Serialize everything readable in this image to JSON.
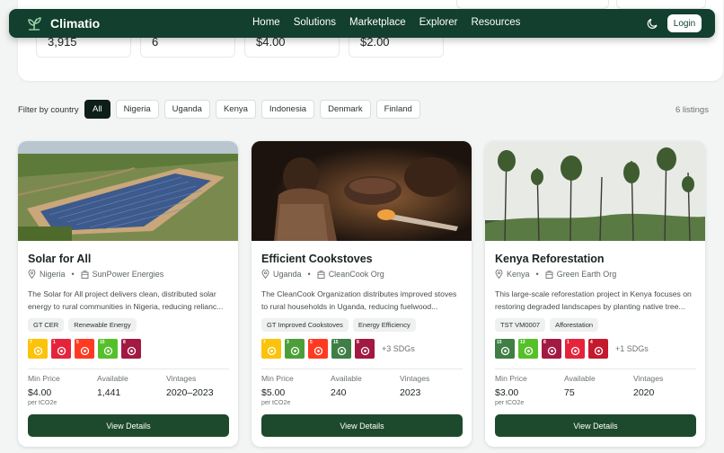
{
  "stats": [
    "3,915",
    "6",
    "$4.00",
    "$2.00"
  ],
  "nav": {
    "brand": "Climatio",
    "links": [
      "Home",
      "Solutions",
      "Marketplace",
      "Explorer",
      "Resources"
    ],
    "login": "Login"
  },
  "filter": {
    "label": "Filter by country",
    "countries": [
      "All",
      "Nigeria",
      "Uganda",
      "Kenya",
      "Indonesia",
      "Denmark",
      "Finland"
    ],
    "selected": "All",
    "listings": "6 listings"
  },
  "cards": [
    {
      "title": "Solar for All",
      "country": "Nigeria",
      "org": "SunPower Energies",
      "desc": "The Solar for All project delivers clean, distributed solar energy to rural communities in Nigeria, reducing relianc...",
      "tags": [
        "GT CER",
        "Renewable Energy"
      ],
      "sdg_more": "",
      "min_price_label": "Min Price",
      "min_price": "$4.00",
      "unit": "per tCO2e",
      "available_label": "Available",
      "available": "1,441",
      "vintages_label": "Vintages",
      "vintages": "2020–2023",
      "button": "View Details"
    },
    {
      "title": "Efficient Cookstoves",
      "country": "Uganda",
      "org": "CleanCook Org",
      "desc": "The CleanCook Organization distributes improved stoves to rural households in Uganda, reducing fuelwood...",
      "tags": [
        "GT Improved Cookstoves",
        "Energy Efficiency"
      ],
      "sdg_more": "+3 SDGs",
      "min_price_label": "Min Price",
      "min_price": "$5.00",
      "unit": "per tCO2e",
      "available_label": "Available",
      "available": "240",
      "vintages_label": "Vintages",
      "vintages": "2023",
      "button": "View Details"
    },
    {
      "title": "Kenya Reforestation",
      "country": "Kenya",
      "org": "Green Earth Org",
      "desc": "This large-scale reforestation project in Kenya focuses on restoring degraded landscapes by planting native tree...",
      "tags": [
        "TST VM0007",
        "Afforestation"
      ],
      "sdg_more": "+1 SDGs",
      "min_price_label": "Min Price",
      "min_price": "$3.00",
      "unit": "per tCO2e",
      "available_label": "Available",
      "available": "75",
      "vintages_label": "Vintages",
      "vintages": "2020",
      "button": "View Details"
    }
  ],
  "sdg_sets": [
    [
      {
        "n": "7",
        "color": "#fcc30b"
      },
      {
        "n": "1",
        "color": "#e5243b"
      },
      {
        "n": "5",
        "color": "#ff3a21"
      },
      {
        "n": "15",
        "color": "#56c02b"
      },
      {
        "n": "8",
        "color": "#a21942"
      }
    ],
    [
      {
        "n": "7",
        "color": "#fcc30b"
      },
      {
        "n": "3",
        "color": "#4c9f38"
      },
      {
        "n": "5",
        "color": "#ff3a21"
      },
      {
        "n": "15",
        "color": "#3f7e44"
      },
      {
        "n": "8",
        "color": "#a21942"
      }
    ],
    [
      {
        "n": "15",
        "color": "#3f7e44"
      },
      {
        "n": "13",
        "color": "#56c02b"
      },
      {
        "n": "8",
        "color": "#a21942"
      },
      {
        "n": "1",
        "color": "#e5243b"
      },
      {
        "n": "4",
        "color": "#c5192d"
      }
    ]
  ],
  "colors": {
    "nav": "#123f2e",
    "button": "#1d4a2c",
    "accent_active_chip": "#0d1f18"
  }
}
